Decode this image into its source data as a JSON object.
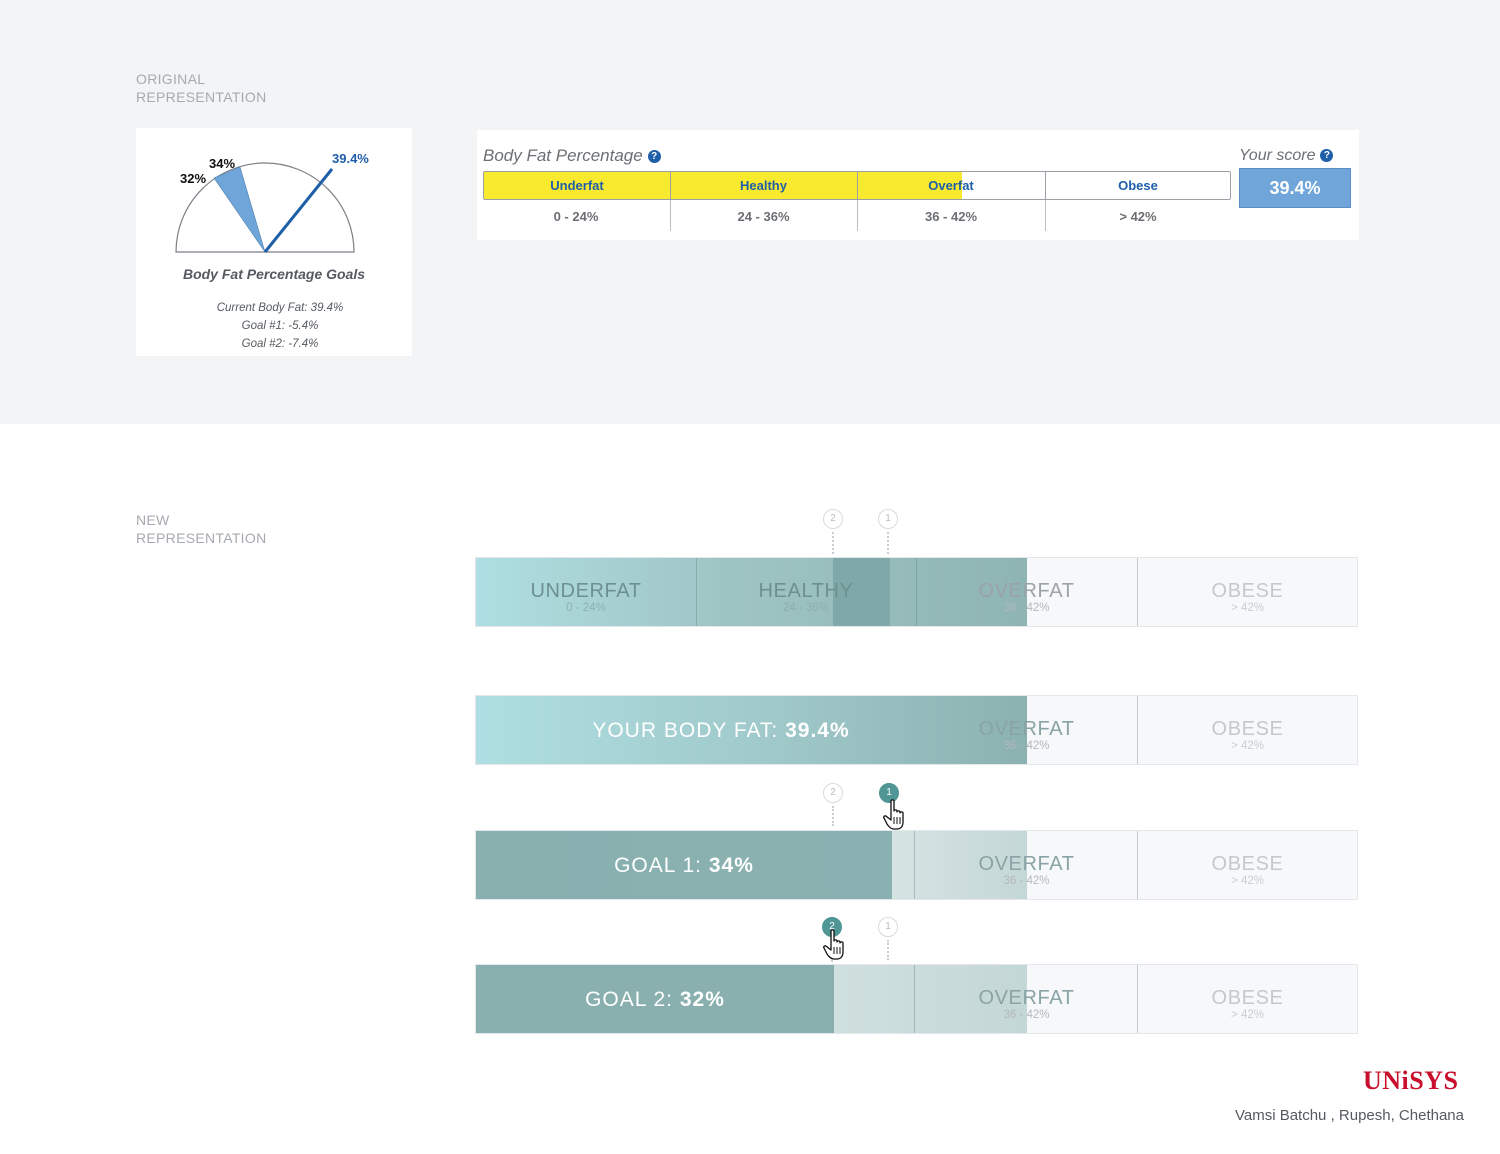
{
  "sections": {
    "original_label": "ORIGINAL\nREPRESENTATION",
    "new_label": "NEW\nREPRESENTATION"
  },
  "gauge": {
    "labels": {
      "goal2": "32%",
      "goal1": "34%",
      "current": "39.4%"
    },
    "caption": "Body Fat Percentage Goals",
    "lines": [
      "Current Body Fat: 39.4%",
      "Goal #1: -5.4%",
      "Goal #2: -7.4%"
    ],
    "colors": {
      "wedge": "#6fa5d9",
      "needle": "#1f5fa8",
      "current_label": "#1f5fa8"
    }
  },
  "original_bar": {
    "title": "Body Fat Percentage",
    "help_icon": "?",
    "score_title": "Your score",
    "score_value": "39.4%",
    "segments": [
      {
        "label": "Underfat",
        "range": "0 - 24%"
      },
      {
        "label": "Healthy",
        "range": "24 - 36%"
      },
      {
        "label": "Overfat",
        "range": "36 - 42%"
      },
      {
        "label": "Obese",
        "range": "> 42%"
      }
    ],
    "fill_value_percent": 39.4,
    "fill_color": "#f9e92f"
  },
  "new_bars": {
    "categories": [
      {
        "label": "UNDERFAT",
        "range": "0 - 24%"
      },
      {
        "label": "HEALTHY",
        "range": "24 - 36%"
      },
      {
        "label": "OVERFAT",
        "range": "36 - 42%"
      },
      {
        "label": "OBESE",
        "range": "> 42%"
      }
    ],
    "marker_1": "1",
    "marker_2": "2",
    "your_body_fat": {
      "prefix": "YOUR BODY FAT: ",
      "value": "39.4%"
    },
    "goal_1": {
      "prefix": "GOAL 1: ",
      "value": "34%"
    },
    "goal_2": {
      "prefix": "GOAL 2: ",
      "value": "32%"
    },
    "colors": {
      "teal": "#8ab0b0",
      "teal_light": "#abdde0",
      "marker_active": "#4f9694"
    }
  },
  "footer": {
    "logo": "UNiSYS",
    "credits": "Vamsi Batchu , Rupesh, Chethana"
  }
}
